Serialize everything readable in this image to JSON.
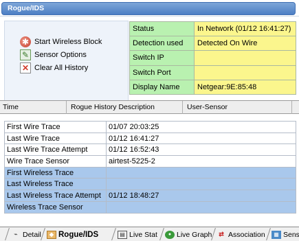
{
  "window": {
    "title": "Rogue/IDS"
  },
  "actions": [
    {
      "label": "Start Wireless Block",
      "icon": "wireless-block-icon"
    },
    {
      "label": "Sensor Options",
      "icon": "sensor-options-icon"
    },
    {
      "label": "Clear All History",
      "icon": "clear-history-icon"
    }
  ],
  "status": [
    {
      "label": "Status",
      "value": "In Network (01/12 16:41:27)"
    },
    {
      "label": "Detection used",
      "value": "Detected On Wire"
    },
    {
      "label": "Switch IP",
      "value": ""
    },
    {
      "label": "Switch Port",
      "value": ""
    },
    {
      "label": "Display Name",
      "value": "Netgear:9E:85:48"
    }
  ],
  "history": {
    "columns": [
      "Time",
      "Rogue History Description",
      "User-Sensor"
    ]
  },
  "traces": [
    {
      "label": "First Wire Trace",
      "value": "01/07 20:03:25",
      "highlight": false
    },
    {
      "label": "Last Wire Trace",
      "value": "01/12 16:41:27",
      "highlight": false
    },
    {
      "label": "Last Wire Trace Attempt",
      "value": "01/12 16:52:43",
      "highlight": false
    },
    {
      "label": "Wire Trace Sensor",
      "value": "airtest-5225-2",
      "highlight": false
    },
    {
      "label": "First Wireless Trace",
      "value": "",
      "highlight": true
    },
    {
      "label": "Last Wireless Trace",
      "value": "",
      "highlight": true
    },
    {
      "label": "Last Wireless Trace Attempt",
      "value": "01/12 18:48:27",
      "highlight": true
    },
    {
      "label": "Wireless Trace Sensor",
      "value": "",
      "highlight": true
    }
  ],
  "tabs": [
    {
      "label": "Detail",
      "icon": "detail-icon",
      "active": false
    },
    {
      "label": "Rogue/IDS",
      "icon": "rogue-ids-icon",
      "active": true
    },
    {
      "label": "Live Stat",
      "icon": "live-stat-icon",
      "active": false
    },
    {
      "label": "Live Graph",
      "icon": "live-graph-icon",
      "active": false
    },
    {
      "label": "Association",
      "icon": "association-icon",
      "active": false
    },
    {
      "label": "Sensor",
      "icon": "sensor-icon",
      "active": false
    }
  ],
  "colors": {
    "status_key_bg": "#b9f1b0",
    "status_value_bg": "#fbf68d",
    "wireless_row_bg": "#a9c8ec",
    "title_bar": "#5a88c8"
  }
}
